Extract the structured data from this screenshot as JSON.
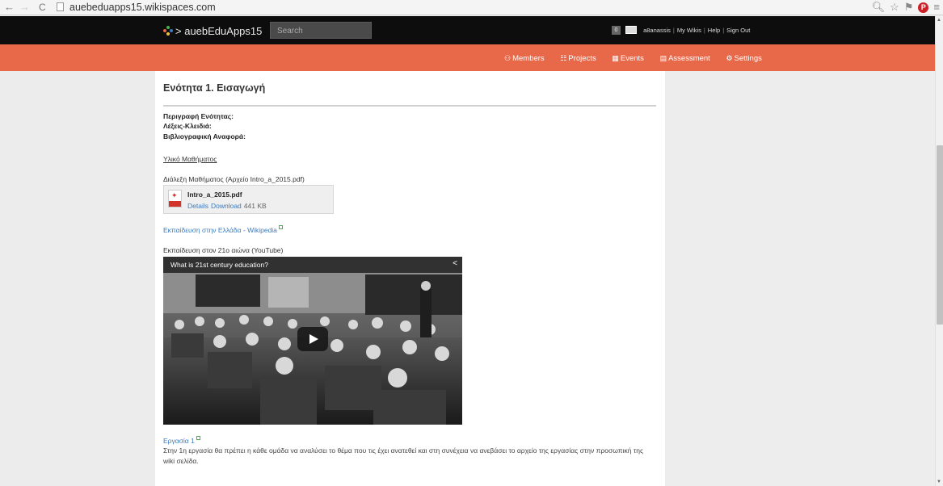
{
  "browser": {
    "url": "auebeduapps15.wikispaces.com",
    "back_icon": "←",
    "forward_icon": "→",
    "reload_icon": "C"
  },
  "header": {
    "site_title": "auebEduApps15",
    "search_placeholder": "Search",
    "notification_count": "0",
    "username": "a8anassis",
    "links": [
      "My Wikis",
      "Help",
      "Sign Out"
    ]
  },
  "nav": {
    "items": [
      {
        "icon": "members-icon",
        "label": "Members"
      },
      {
        "icon": "projects-icon",
        "label": "Projects"
      },
      {
        "icon": "events-icon",
        "label": "Events"
      },
      {
        "icon": "assessment-icon",
        "label": "Assessment"
      },
      {
        "icon": "settings-icon",
        "label": "Settings"
      }
    ]
  },
  "page": {
    "title": "Ενότητα 1. Εισαγωγή",
    "meta": [
      "Περιγραφή Ενότητας:",
      "Λέξεις-Κλειδιά:",
      "Βιβλιογραφική Αναφορά:"
    ],
    "material_link": "Υλικό Μαθήματος",
    "lecture_caption": "Διάλεξη Μαθήματος (Αρχείο Intro_a_2015.pdf)",
    "file": {
      "name": "Intro_a_2015.pdf",
      "details_label": "Details",
      "download_label": "Download",
      "size": "441 KB"
    },
    "wiki_link": "Εκπαίδευση στην Ελλάδα - Wikipedia",
    "video_caption": "Εκπαίδευση στον 21ο αιώνα (YouTube)",
    "video_title": "What is 21st century education?",
    "assignment_link": "Εργασία 1",
    "assignment_text": "Στην 1η εργασία θα πρέπει η κάθε ομάδα να αναλύσει το θέμα που τις έχει ανατεθεί και στη συνέχεια να ανεβάσει το αρχείο της εργασίας στην προσωπική της wiki σελίδα."
  },
  "colors": {
    "nav_bg": "#e8694a",
    "topbar_bg": "#0d0d0d",
    "link": "#3b7bbf"
  }
}
